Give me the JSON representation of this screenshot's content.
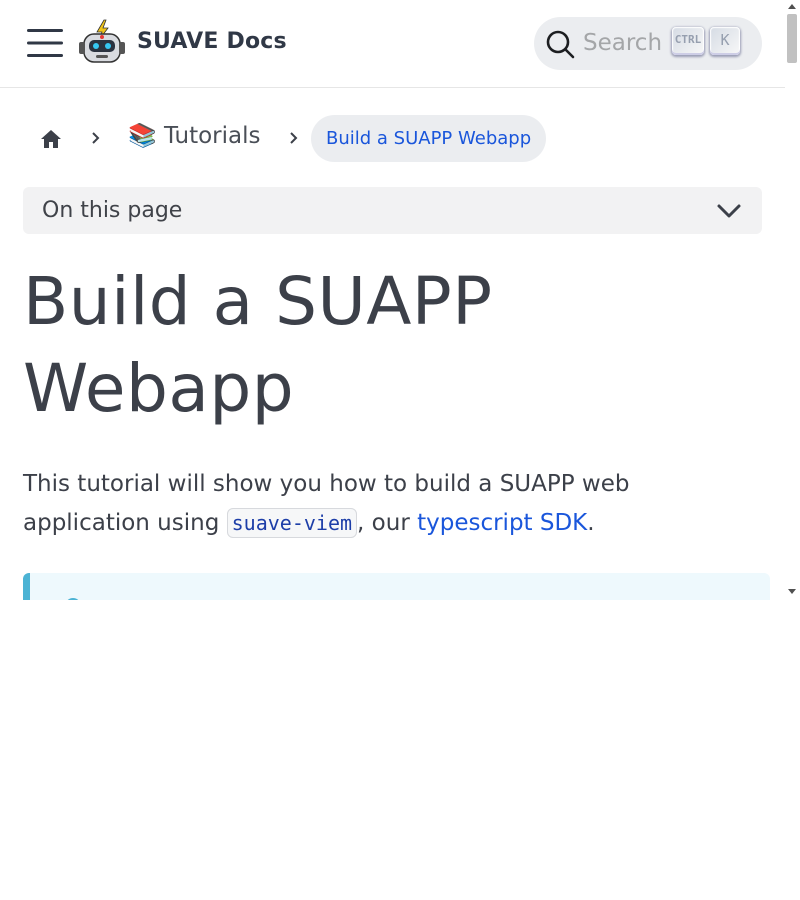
{
  "navbar": {
    "brand": "SUAVE Docs",
    "menu_icon": "hamburger-menu-icon",
    "logo_icon": "robot-logo-icon",
    "search": {
      "placeholder": "Search",
      "shortcut_modifier": "CTRL",
      "shortcut_key": "K",
      "icon": "search-icon"
    }
  },
  "breadcrumbs": {
    "home_icon": "home-icon",
    "items": [
      {
        "label": "📚 Tutorials"
      },
      {
        "label": "Build a SUAPP Webapp"
      }
    ]
  },
  "toc": {
    "label": "On this page",
    "icon": "chevron-down-icon"
  },
  "article": {
    "title": "Build a SUAPP Webapp",
    "intro_before": "This tutorial will show you how to build a SUAPP web application using ",
    "intro_code": "suave-viem",
    "intro_middle": ", our ",
    "intro_link": "typescript SDK",
    "intro_after": "."
  },
  "colors": {
    "link": "#1a56db",
    "admonition_border": "#4cb3d4",
    "admonition_bg": "#eef9fd"
  }
}
